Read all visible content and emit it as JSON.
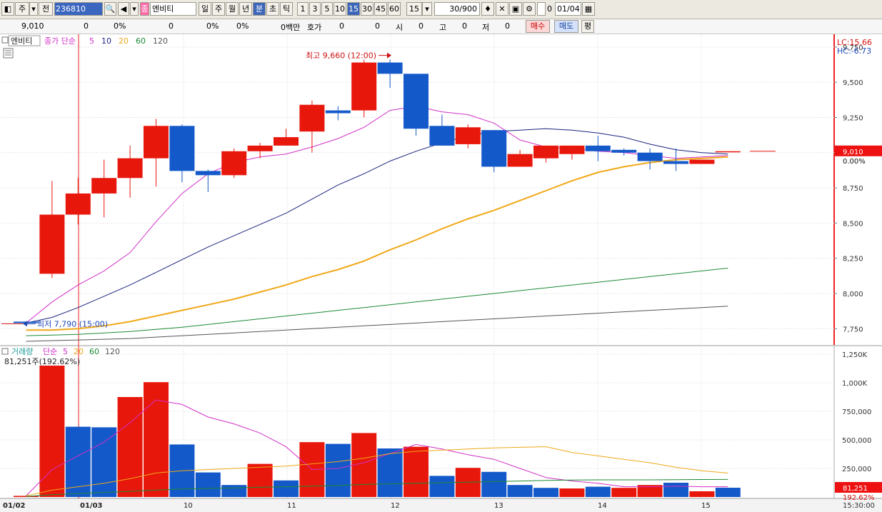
{
  "toolbar": {
    "mode_label": "주",
    "prev_label": "전",
    "code": "236810",
    "stock_tag": "종",
    "stock_name": "엔비티",
    "periods": [
      "일",
      "주",
      "월",
      "년",
      "분",
      "초",
      "틱"
    ],
    "active_period": "분",
    "intervals": [
      "1",
      "3",
      "5",
      "10",
      "15",
      "30",
      "45",
      "60"
    ],
    "active_interval": "15",
    "interval_value": "15",
    "count": "30",
    "count_total": "/900",
    "check_label": "0",
    "date": "01/04"
  },
  "infobar": {
    "price": "9,010",
    "change": "0",
    "change_pct": "0%",
    "volume": "0",
    "volume_pct": "0%",
    "amount_pct": "0%",
    "amount": "0백만",
    "quote_label": "호가",
    "quote": "0",
    "quote2": "0",
    "open_label": "시",
    "open": "0",
    "high_label": "고",
    "high": "0",
    "low_label": "저",
    "low": "0",
    "buy_label": "매수",
    "sell_label": "매도",
    "avg_label": "평"
  },
  "colors": {
    "up": "#e8170c",
    "down": "#1459c9",
    "ma5": "#d12fc7",
    "ma10": "#1a237e",
    "ma20": "#f0a818",
    "ma60": "#1b8a33",
    "ma120": "#555555"
  },
  "chart_data": [
    {
      "type": "candlestick",
      "legend": {
        "stock": "엔비티",
        "label": "종가 단순",
        "periods": [
          "5",
          "10",
          "20",
          "60",
          "120"
        ]
      },
      "ylim": [
        7650,
        9800
      ],
      "yticks": [
        "7,750",
        "8,000",
        "8,250",
        "8,500",
        "8,750",
        "9,000",
        "9,250",
        "9,500",
        "9,750"
      ],
      "xticks": [
        "01/02",
        "01/03",
        "10",
        "11",
        "12",
        "13",
        "14",
        "15"
      ],
      "lc_label": "LC:15.66",
      "hc_label": "HC:-6.73",
      "last_price_label": "9,010",
      "last_pct_label": "0.00%",
      "high_annotation": "최고 9,660 (12:00)",
      "low_annotation": "최저 7,790 (15:00)",
      "candles": [
        {
          "o": 7800,
          "h": 7800,
          "l": 7790,
          "c": 7790
        },
        {
          "o": 8140,
          "h": 8800,
          "l": 8110,
          "c": 8560
        },
        {
          "o": 8560,
          "h": 8820,
          "l": 8490,
          "c": 8710
        },
        {
          "o": 8710,
          "h": 8950,
          "l": 8540,
          "c": 8820
        },
        {
          "o": 8820,
          "h": 9050,
          "l": 8680,
          "c": 8960
        },
        {
          "o": 8960,
          "h": 9240,
          "l": 8760,
          "c": 9190
        },
        {
          "o": 9190,
          "h": 9200,
          "l": 8790,
          "c": 8870
        },
        {
          "o": 8870,
          "h": 8880,
          "l": 8720,
          "c": 8840
        },
        {
          "o": 8840,
          "h": 9030,
          "l": 8820,
          "c": 9010
        },
        {
          "o": 9010,
          "h": 9070,
          "l": 8960,
          "c": 9050
        },
        {
          "o": 9050,
          "h": 9170,
          "l": 9050,
          "c": 9110
        },
        {
          "o": 9150,
          "h": 9370,
          "l": 9000,
          "c": 9340
        },
        {
          "o": 9300,
          "h": 9330,
          "l": 9230,
          "c": 9280
        },
        {
          "o": 9300,
          "h": 9660,
          "l": 9250,
          "c": 9640
        },
        {
          "o": 9640,
          "h": 9660,
          "l": 9460,
          "c": 9560
        },
        {
          "o": 9560,
          "h": 9560,
          "l": 9120,
          "c": 9170
        },
        {
          "o": 9190,
          "h": 9270,
          "l": 9050,
          "c": 9050
        },
        {
          "o": 9060,
          "h": 9200,
          "l": 9030,
          "c": 9180
        },
        {
          "o": 9160,
          "h": 9160,
          "l": 8860,
          "c": 8900
        },
        {
          "o": 8900,
          "h": 9020,
          "l": 8900,
          "c": 8990
        },
        {
          "o": 8960,
          "h": 9050,
          "l": 8930,
          "c": 9050
        },
        {
          "o": 8990,
          "h": 9050,
          "l": 8950,
          "c": 9050
        },
        {
          "o": 9050,
          "h": 9120,
          "l": 8940,
          "c": 9010
        },
        {
          "o": 9020,
          "h": 9030,
          "l": 8980,
          "c": 9000
        },
        {
          "o": 9000,
          "h": 9030,
          "l": 8880,
          "c": 8940
        },
        {
          "o": 8940,
          "h": 9030,
          "l": 8870,
          "c": 8920
        },
        {
          "o": 8920,
          "h": 8950,
          "l": 8920,
          "c": 8950
        },
        {
          "o": 9010,
          "h": 9010,
          "l": 9010,
          "c": 9010
        }
      ],
      "series": [
        {
          "name": "5",
          "values": [
            7790,
            7940,
            8060,
            8160,
            8290,
            8510,
            8710,
            8850,
            8930,
            8970,
            8990,
            9040,
            9100,
            9180,
            9300,
            9330,
            9290,
            9270,
            9210,
            9090,
            9040,
            9030,
            9010,
            9000,
            8980,
            8960,
            8970,
            8980
          ]
        },
        {
          "name": "10",
          "values": [
            7790,
            7830,
            7900,
            7980,
            8060,
            8150,
            8240,
            8330,
            8410,
            8490,
            8570,
            8670,
            8770,
            8850,
            8940,
            9010,
            9070,
            9120,
            9150,
            9160,
            9170,
            9160,
            9140,
            9110,
            9060,
            9020,
            9000,
            8990
          ]
        },
        {
          "name": "20",
          "values": [
            7740,
            7740,
            7750,
            7770,
            7800,
            7840,
            7880,
            7920,
            7960,
            8010,
            8060,
            8120,
            8170,
            8230,
            8310,
            8380,
            8460,
            8530,
            8590,
            8660,
            8730,
            8800,
            8860,
            8900,
            8930,
            8950,
            8960,
            8970
          ]
        },
        {
          "name": "60",
          "values": [
            7700,
            7705,
            7710,
            7720,
            7730,
            7745,
            7760,
            7780,
            7800,
            7820,
            7840,
            7860,
            7880,
            7900,
            7920,
            7940,
            7960,
            7980,
            8000,
            8020,
            8040,
            8060,
            8080,
            8100,
            8120,
            8140,
            8160,
            8180
          ]
        },
        {
          "name": "120",
          "values": [
            7660,
            7665,
            7670,
            7675,
            7680,
            7690,
            7700,
            7710,
            7720,
            7730,
            7740,
            7750,
            7760,
            7770,
            7780,
            7790,
            7800,
            7810,
            7820,
            7830,
            7840,
            7850,
            7860,
            7870,
            7880,
            7890,
            7900,
            7910
          ]
        }
      ]
    },
    {
      "type": "bar",
      "legend": {
        "label": "거래량",
        "method": "단순",
        "periods": [
          "5",
          "20",
          "60",
          "120"
        ]
      },
      "current_label": "81,251주(192.62%)",
      "ylim": [
        0,
        1300000
      ],
      "yticks": [
        "250,000",
        "500,000",
        "750,000",
        "1,000K",
        "1,250K"
      ],
      "last_value_label": "81,251",
      "last_pct_label": "192.62%",
      "time_label": "15:30:00",
      "up": [
        true,
        true,
        false,
        false,
        true,
        true,
        false,
        false,
        false,
        true,
        false,
        true,
        false,
        true,
        false,
        true,
        false,
        true,
        false,
        false,
        false,
        true,
        false,
        true,
        true,
        false,
        true
      ],
      "values": [
        10000,
        1150000,
        615000,
        610000,
        875000,
        1005000,
        460000,
        215000,
        105000,
        290000,
        145000,
        480000,
        465000,
        560000,
        425000,
        440000,
        185000,
        255000,
        220000,
        105000,
        80000,
        75000,
        90000,
        80000,
        105000,
        125000,
        50000,
        81251
      ],
      "series": [
        {
          "name": "5",
          "values": [
            10000,
            240000,
            360000,
            480000,
            650000,
            850000,
            810000,
            700000,
            640000,
            560000,
            440000,
            240000,
            250000,
            300000,
            380000,
            460000,
            420000,
            370000,
            330000,
            250000,
            170000,
            140000,
            120000,
            90000,
            90000,
            95000,
            90000,
            90000
          ]
        },
        {
          "name": "20",
          "values": [
            10000,
            60000,
            90000,
            120000,
            160000,
            210000,
            230000,
            240000,
            250000,
            260000,
            270000,
            290000,
            310000,
            340000,
            380000,
            400000,
            410000,
            420000,
            430000,
            435000,
            440000,
            390000,
            360000,
            330000,
            300000,
            260000,
            230000,
            210000
          ]
        },
        {
          "name": "60",
          "values": [
            5000,
            20000,
            30000,
            40000,
            50000,
            60000,
            70000,
            75000,
            80000,
            85000,
            90000,
            95000,
            100000,
            110000,
            115000,
            120000,
            125000,
            130000,
            135000,
            140000,
            145000,
            148000,
            150000,
            150000,
            150000,
            152000,
            153000,
            154000
          ]
        }
      ]
    }
  ]
}
